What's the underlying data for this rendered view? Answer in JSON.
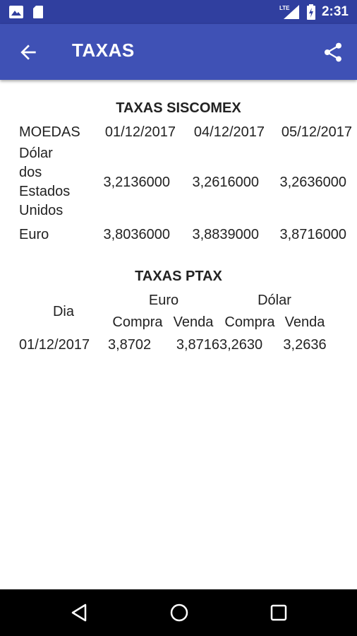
{
  "status": {
    "time": "2:31",
    "network": "LTE"
  },
  "appbar": {
    "title": "TAXAS"
  },
  "siscomex": {
    "title": "TAXAS SISCOMEX",
    "header": [
      "MOEDAS",
      "01/12/2017",
      "04/12/2017",
      "05/12/2017"
    ],
    "rows": [
      {
        "currency": [
          "Dólar",
          "dos",
          "Estados",
          "Unidos"
        ],
        "values": [
          "3,2136000",
          "3,2616000",
          "3,2636000"
        ]
      },
      {
        "currency": [
          "Euro"
        ],
        "values": [
          "3,8036000",
          "3,8839000",
          "3,8716000"
        ]
      }
    ]
  },
  "ptax": {
    "title": "TAXAS PTAX",
    "dia_label": "Dia",
    "euro_label": "Euro",
    "dolar_label": "Dólar",
    "compra_label": "Compra",
    "venda_label": "Venda",
    "row": {
      "dia": "01/12/2017",
      "euro_compra": "3,8702",
      "euro_venda": "3,8716",
      "dolar_compra": "3,2630",
      "dolar_venda": "3,2636"
    }
  },
  "icons": {
    "back": "arrow-back-icon",
    "share": "share-icon"
  }
}
